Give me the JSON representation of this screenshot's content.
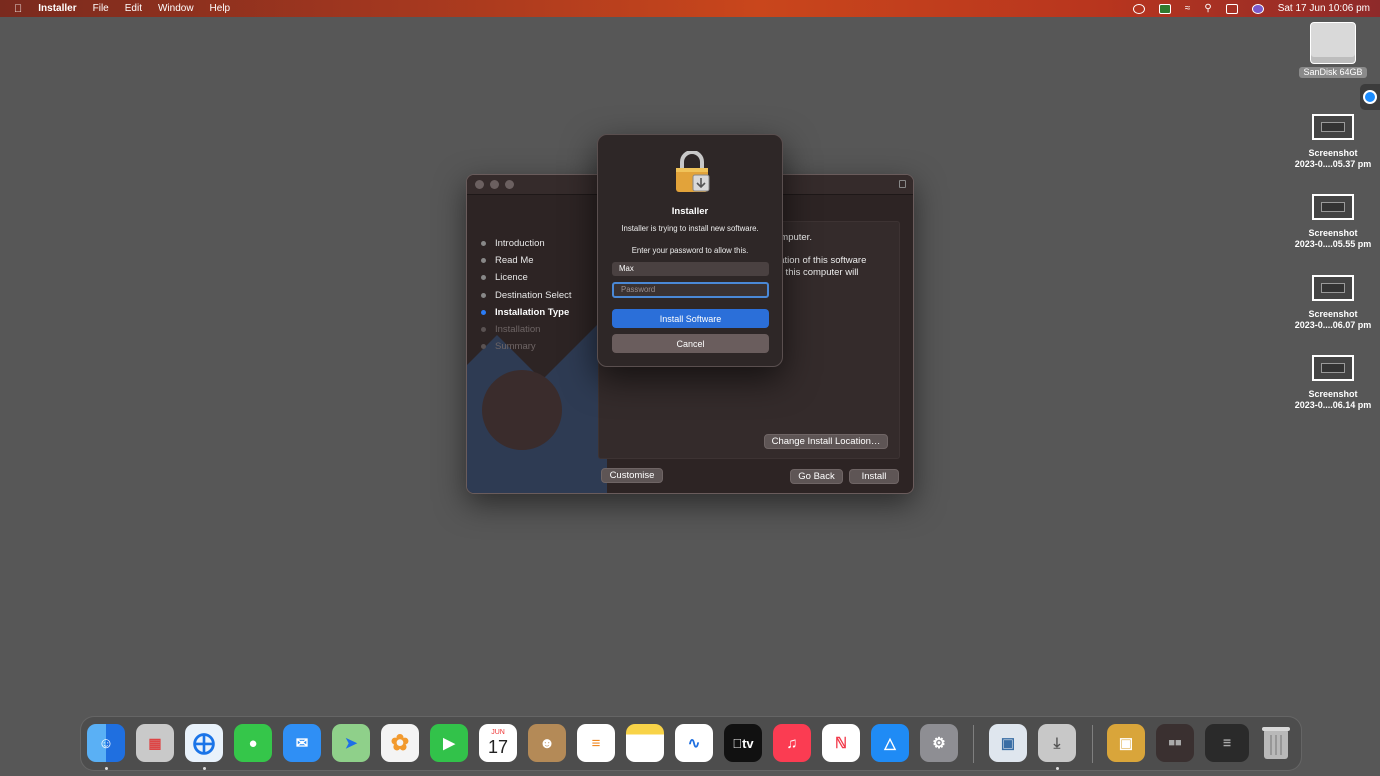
{
  "menubar": {
    "app": "Installer",
    "items": [
      "File",
      "Edit",
      "Window",
      "Help"
    ],
    "datetime": "Sat 17 Jun  10:06 pm"
  },
  "desktop": {
    "drive_label": "SanDisk 64GB",
    "screenshots": [
      {
        "line1": "Screenshot",
        "line2": "2023-0....05.37 pm"
      },
      {
        "line1": "Screenshot",
        "line2": "2023-0....05.55 pm"
      },
      {
        "line1": "Screenshot",
        "line2": "2023-0....06.07 pm"
      },
      {
        "line1": "Screenshot",
        "line2": "2023-0....06.14 pm"
      }
    ]
  },
  "installer": {
    "steps": [
      "Introduction",
      "Read Me",
      "Licence",
      "Destination Select",
      "Installation Type",
      "Installation",
      "Summary"
    ],
    "content_line1": "omputer.",
    "content_line2": "llation of this software",
    "content_line3": "of this computer will",
    "change_location": "Change Install Location…",
    "customise": "Customise",
    "go_back": "Go Back",
    "install": "Install"
  },
  "auth_dialog": {
    "title": "Installer",
    "subtitle": "Installer is trying to install new software.",
    "prompt": "Enter your password to allow this.",
    "username": "Max",
    "password_placeholder": "Password",
    "primary_button": "Install Software",
    "cancel_button": "Cancel"
  },
  "dock": {
    "apps": [
      "Finder",
      "Launchpad",
      "Safari",
      "Messages",
      "Mail",
      "Maps",
      "Photos",
      "FaceTime",
      "Calendar",
      "Contacts",
      "Reminders",
      "Notes",
      "Freeform",
      "TV",
      "Music",
      "News",
      "App Store",
      "System Settings",
      "Preview",
      "Installer",
      "Package",
      "Screenshots",
      "Documents",
      "Trash"
    ],
    "calendar_month": "JUN",
    "calendar_day": "17",
    "tv_label": "tv"
  },
  "colors": {
    "accent": "#2b6fd9",
    "desktop": "#575757",
    "menubar": "#b8351e"
  }
}
